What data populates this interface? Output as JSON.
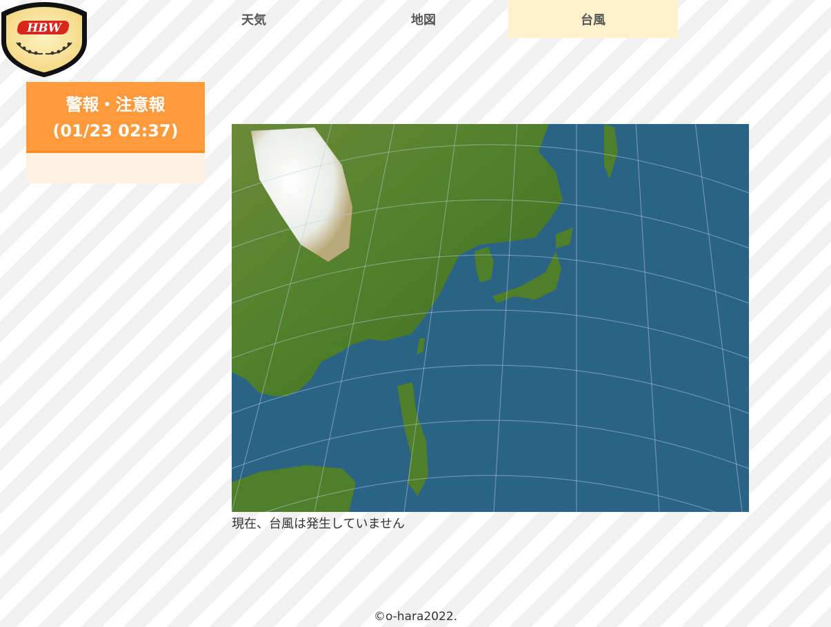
{
  "logo": {
    "text": "HBW"
  },
  "nav": {
    "tabs": [
      {
        "label": "天気",
        "active": false
      },
      {
        "label": "地図",
        "active": false
      },
      {
        "label": "台風",
        "active": true
      }
    ]
  },
  "alerts": {
    "title": "警報・注意報",
    "timestamp": "(01/23 02:37)"
  },
  "typhoon": {
    "status": "現在、台風は発生していません"
  },
  "footer": {
    "copyright": "©o-hara2022."
  },
  "colors": {
    "accent": "#ff9a3c",
    "active_tab": "#fff1cc",
    "ocean": "#2b6387",
    "land": "#4f7f2a"
  }
}
